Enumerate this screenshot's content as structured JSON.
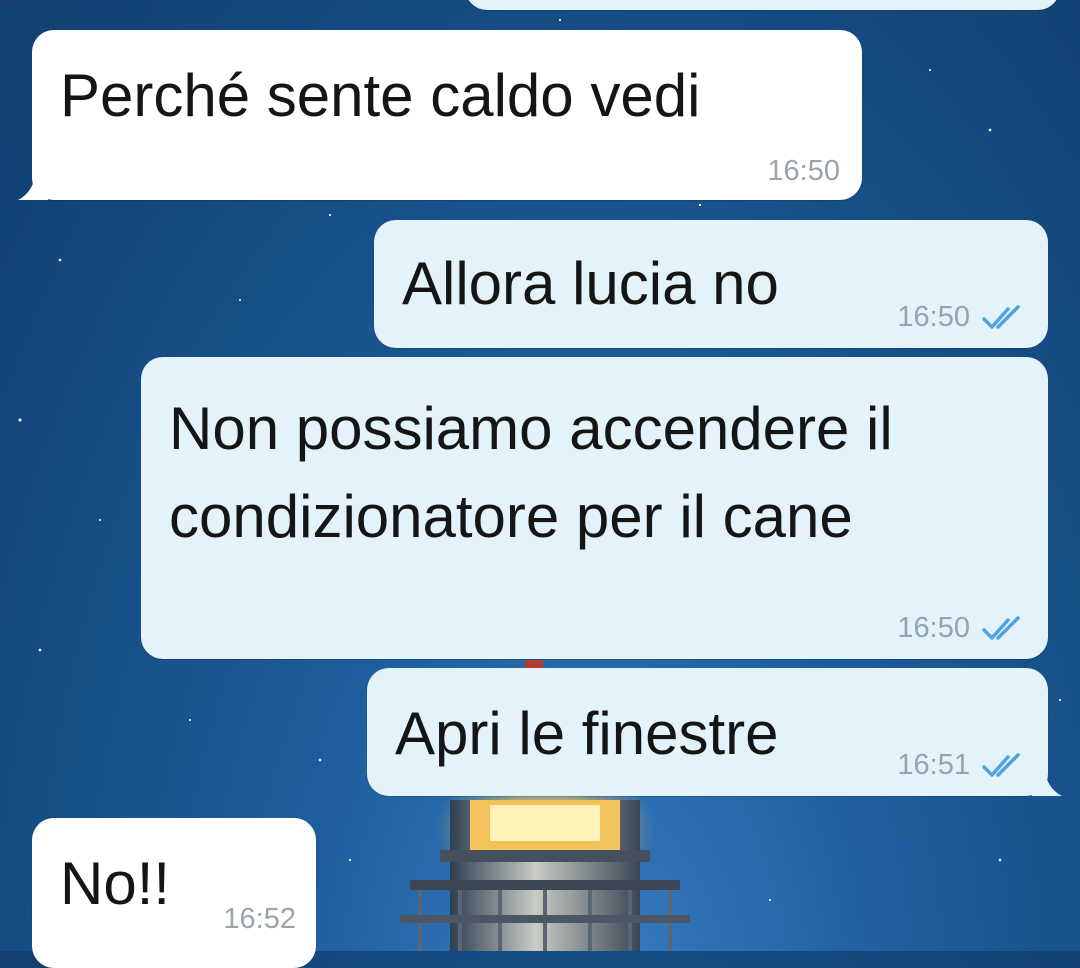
{
  "chat": {
    "messages": [
      {
        "direction": "incoming",
        "text": "Perché sente caldo vedi",
        "time": "16:50"
      },
      {
        "direction": "outgoing",
        "text": "Allora lucia no",
        "time": "16:50",
        "status": "read"
      },
      {
        "direction": "outgoing",
        "text": "Non possiamo accendere il condizionatore per il cane",
        "time": "16:50",
        "status": "read"
      },
      {
        "direction": "outgoing",
        "text": "Apri le finestre",
        "time": "16:51",
        "status": "read"
      },
      {
        "direction": "incoming",
        "text": "No!!",
        "time": "16:52"
      }
    ]
  },
  "colors": {
    "incoming_bubble": "#ffffff",
    "outgoing_bubble": "#e4f2fa",
    "read_check": "#4fa3e0",
    "wallpaper": "#1f5f9e"
  },
  "icons": {
    "read_receipt": "double-check-icon"
  }
}
